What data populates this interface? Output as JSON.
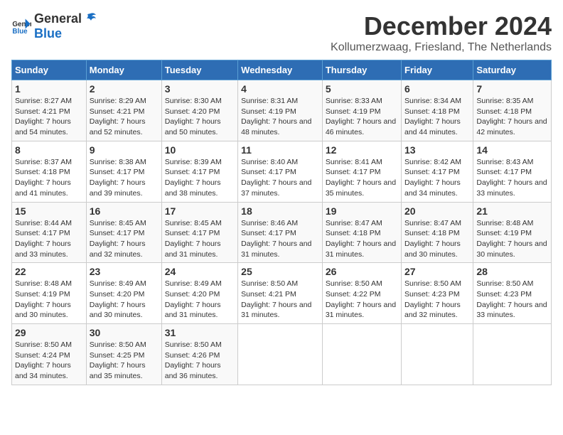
{
  "header": {
    "logo_general": "General",
    "logo_blue": "Blue",
    "title": "December 2024",
    "subtitle": "Kollumerzwaag, Friesland, The Netherlands"
  },
  "days_of_week": [
    "Sunday",
    "Monday",
    "Tuesday",
    "Wednesday",
    "Thursday",
    "Friday",
    "Saturday"
  ],
  "weeks": [
    [
      {
        "day": "1",
        "sunrise": "8:27 AM",
        "sunset": "4:21 PM",
        "daylight": "7 hours and 54 minutes."
      },
      {
        "day": "2",
        "sunrise": "8:29 AM",
        "sunset": "4:21 PM",
        "daylight": "7 hours and 52 minutes."
      },
      {
        "day": "3",
        "sunrise": "8:30 AM",
        "sunset": "4:20 PM",
        "daylight": "7 hours and 50 minutes."
      },
      {
        "day": "4",
        "sunrise": "8:31 AM",
        "sunset": "4:19 PM",
        "daylight": "7 hours and 48 minutes."
      },
      {
        "day": "5",
        "sunrise": "8:33 AM",
        "sunset": "4:19 PM",
        "daylight": "7 hours and 46 minutes."
      },
      {
        "day": "6",
        "sunrise": "8:34 AM",
        "sunset": "4:18 PM",
        "daylight": "7 hours and 44 minutes."
      },
      {
        "day": "7",
        "sunrise": "8:35 AM",
        "sunset": "4:18 PM",
        "daylight": "7 hours and 42 minutes."
      }
    ],
    [
      {
        "day": "8",
        "sunrise": "8:37 AM",
        "sunset": "4:18 PM",
        "daylight": "7 hours and 41 minutes."
      },
      {
        "day": "9",
        "sunrise": "8:38 AM",
        "sunset": "4:17 PM",
        "daylight": "7 hours and 39 minutes."
      },
      {
        "day": "10",
        "sunrise": "8:39 AM",
        "sunset": "4:17 PM",
        "daylight": "7 hours and 38 minutes."
      },
      {
        "day": "11",
        "sunrise": "8:40 AM",
        "sunset": "4:17 PM",
        "daylight": "7 hours and 37 minutes."
      },
      {
        "day": "12",
        "sunrise": "8:41 AM",
        "sunset": "4:17 PM",
        "daylight": "7 hours and 35 minutes."
      },
      {
        "day": "13",
        "sunrise": "8:42 AM",
        "sunset": "4:17 PM",
        "daylight": "7 hours and 34 minutes."
      },
      {
        "day": "14",
        "sunrise": "8:43 AM",
        "sunset": "4:17 PM",
        "daylight": "7 hours and 33 minutes."
      }
    ],
    [
      {
        "day": "15",
        "sunrise": "8:44 AM",
        "sunset": "4:17 PM",
        "daylight": "7 hours and 33 minutes."
      },
      {
        "day": "16",
        "sunrise": "8:45 AM",
        "sunset": "4:17 PM",
        "daylight": "7 hours and 32 minutes."
      },
      {
        "day": "17",
        "sunrise": "8:45 AM",
        "sunset": "4:17 PM",
        "daylight": "7 hours and 31 minutes."
      },
      {
        "day": "18",
        "sunrise": "8:46 AM",
        "sunset": "4:17 PM",
        "daylight": "7 hours and 31 minutes."
      },
      {
        "day": "19",
        "sunrise": "8:47 AM",
        "sunset": "4:18 PM",
        "daylight": "7 hours and 31 minutes."
      },
      {
        "day": "20",
        "sunrise": "8:47 AM",
        "sunset": "4:18 PM",
        "daylight": "7 hours and 30 minutes."
      },
      {
        "day": "21",
        "sunrise": "8:48 AM",
        "sunset": "4:19 PM",
        "daylight": "7 hours and 30 minutes."
      }
    ],
    [
      {
        "day": "22",
        "sunrise": "8:48 AM",
        "sunset": "4:19 PM",
        "daylight": "7 hours and 30 minutes."
      },
      {
        "day": "23",
        "sunrise": "8:49 AM",
        "sunset": "4:20 PM",
        "daylight": "7 hours and 30 minutes."
      },
      {
        "day": "24",
        "sunrise": "8:49 AM",
        "sunset": "4:20 PM",
        "daylight": "7 hours and 31 minutes."
      },
      {
        "day": "25",
        "sunrise": "8:50 AM",
        "sunset": "4:21 PM",
        "daylight": "7 hours and 31 minutes."
      },
      {
        "day": "26",
        "sunrise": "8:50 AM",
        "sunset": "4:22 PM",
        "daylight": "7 hours and 31 minutes."
      },
      {
        "day": "27",
        "sunrise": "8:50 AM",
        "sunset": "4:23 PM",
        "daylight": "7 hours and 32 minutes."
      },
      {
        "day": "28",
        "sunrise": "8:50 AM",
        "sunset": "4:23 PM",
        "daylight": "7 hours and 33 minutes."
      }
    ],
    [
      {
        "day": "29",
        "sunrise": "8:50 AM",
        "sunset": "4:24 PM",
        "daylight": "7 hours and 34 minutes."
      },
      {
        "day": "30",
        "sunrise": "8:50 AM",
        "sunset": "4:25 PM",
        "daylight": "7 hours and 35 minutes."
      },
      {
        "day": "31",
        "sunrise": "8:50 AM",
        "sunset": "4:26 PM",
        "daylight": "7 hours and 36 minutes."
      },
      null,
      null,
      null,
      null
    ]
  ]
}
